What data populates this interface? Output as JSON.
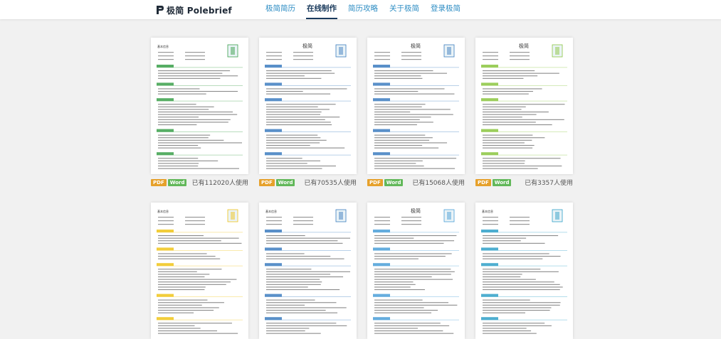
{
  "header": {
    "logo_text": "极简 Polebrief",
    "nav": [
      {
        "label": "极简简历",
        "active": false
      },
      {
        "label": "在线制作",
        "active": true
      },
      {
        "label": "简历攻略",
        "active": false
      },
      {
        "label": "关于极简",
        "active": false
      },
      {
        "label": "登录极简",
        "active": false
      }
    ]
  },
  "templates": [
    {
      "pdf": "PDF",
      "word": "Word",
      "usage": "已有112020人使用",
      "accent": "#3aa04a",
      "title": "基本信息"
    },
    {
      "pdf": "PDF",
      "word": "Word",
      "usage": "已有70535人使用",
      "accent": "#3d7dbf",
      "title": "极简"
    },
    {
      "pdf": "PDF",
      "word": "Word",
      "usage": "已有15068人使用",
      "accent": "#3d7dbf",
      "title": "极简"
    },
    {
      "pdf": "PDF",
      "word": "Word",
      "usage": "已有3357人使用",
      "accent": "#8bc63f",
      "title": "极简"
    },
    {
      "accent": "#f0c419",
      "title": "基本信息"
    },
    {
      "accent": "#3d7dbf",
      "title": "基本信息"
    },
    {
      "accent": "#4a9fd8",
      "title": "极简"
    },
    {
      "accent": "#2fa0c8",
      "title": "基本信息"
    }
  ]
}
